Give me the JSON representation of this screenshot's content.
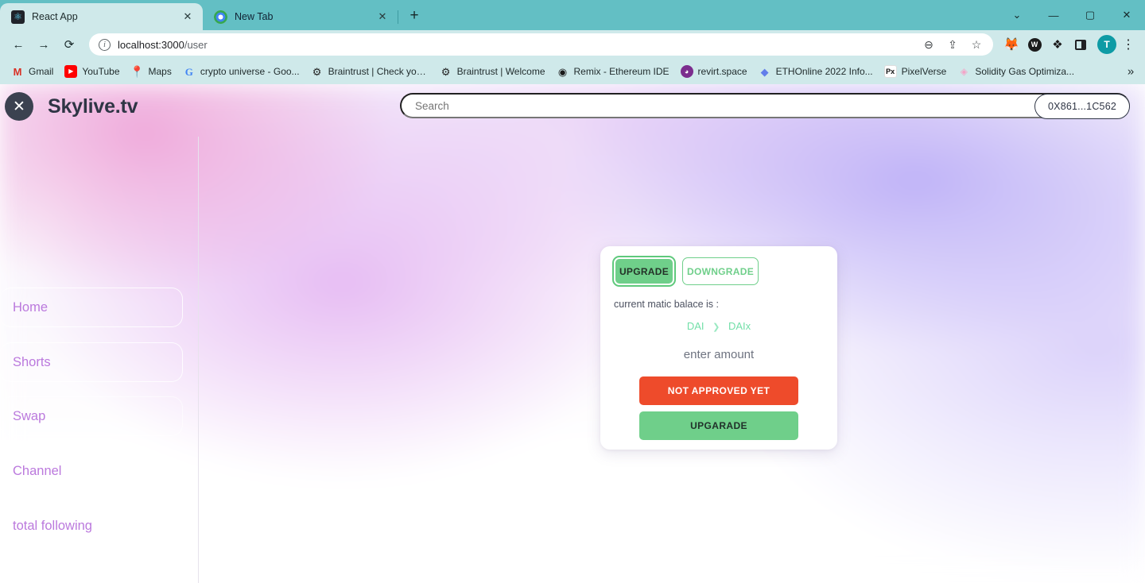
{
  "browser": {
    "tabs": [
      {
        "title": "React App",
        "favicon": "react-icon",
        "active": true
      },
      {
        "title": "New Tab",
        "favicon": "chrome-icon",
        "active": false
      }
    ],
    "new_tab_label": "+",
    "window_controls": {
      "minimize_panel": "⌄",
      "minimize": "—",
      "maximize": "▢",
      "close": "✕"
    },
    "nav": {
      "back": "←",
      "forward": "→",
      "reload": "⟳"
    },
    "omnibox": {
      "host": "localhost:3000",
      "path": "/user",
      "full_url": "localhost:3000/user",
      "info_icon": "i",
      "zoom_icon": "⊖",
      "share_icon": "⇪",
      "bookmark_icon": "☆"
    },
    "extensions": [
      {
        "name": "metamask-icon",
        "glyph": "🦊"
      },
      {
        "name": "wallet-icon",
        "glyph": "W"
      },
      {
        "name": "puzzle-icon",
        "glyph": "🧩"
      },
      {
        "name": "side-panel-icon",
        "glyph": ""
      }
    ],
    "profile_initial": "T",
    "menu_icon": "⋮",
    "bookmarks": [
      {
        "label": "Gmail",
        "icon": "gmail-icon",
        "glyph": "M"
      },
      {
        "label": "YouTube",
        "icon": "youtube-icon",
        "glyph": "▶"
      },
      {
        "label": "Maps",
        "icon": "maps-icon",
        "glyph": "📍"
      },
      {
        "label": "crypto universe - Goo...",
        "icon": "google-icon",
        "glyph": "G"
      },
      {
        "label": "Braintrust | Check you...",
        "icon": "gear-icon",
        "glyph": "⚙"
      },
      {
        "label": "Braintrust | Welcome",
        "icon": "gear-icon",
        "glyph": "⚙"
      },
      {
        "label": "Remix - Ethereum IDE",
        "icon": "remix-icon",
        "glyph": "◉"
      },
      {
        "label": "revirt.space",
        "icon": "revirt-icon",
        "glyph": "◕"
      },
      {
        "label": "ETHOnline 2022 Info...",
        "icon": "ethereum-icon",
        "glyph": "◆"
      },
      {
        "label": "PixelVerse",
        "icon": "pixelverse-icon",
        "glyph": "Px"
      },
      {
        "label": "Solidity Gas Optimiza...",
        "icon": "solidity-icon",
        "glyph": "◈"
      }
    ],
    "bookmarks_overflow": "»"
  },
  "app": {
    "logo_glyph": "✕",
    "brand": "Skylive.tv",
    "search": {
      "placeholder": "Search",
      "value": ""
    },
    "wallet_address": "0X861...1C562",
    "sidebar": {
      "items": [
        {
          "label": "Home"
        },
        {
          "label": "Shorts"
        },
        {
          "label": "Swap"
        },
        {
          "label": "Channel"
        },
        {
          "label": "total following"
        }
      ]
    },
    "card": {
      "tabs": [
        {
          "label": "UPGRADE",
          "active": true
        },
        {
          "label": "DOWNGRADE",
          "active": false
        }
      ],
      "balance_label": "current matic balace is :",
      "token_from": "DAI",
      "token_arrow": "❯",
      "token_to": "DAIx",
      "amount_input": {
        "placeholder": "enter amount",
        "value": ""
      },
      "approve_button": "NOT APPROVED YET",
      "upgrade_button": "UPGARADE"
    }
  },
  "colors": {
    "browser_chrome": "#63bfc4",
    "toolbar": "#cfe9ea",
    "accent_green": "#6fcf8a",
    "danger_red": "#ee4b2b",
    "token_green": "#72dfa8",
    "nav_text": "#bb79dd",
    "brand_dark": "#2f3545"
  }
}
